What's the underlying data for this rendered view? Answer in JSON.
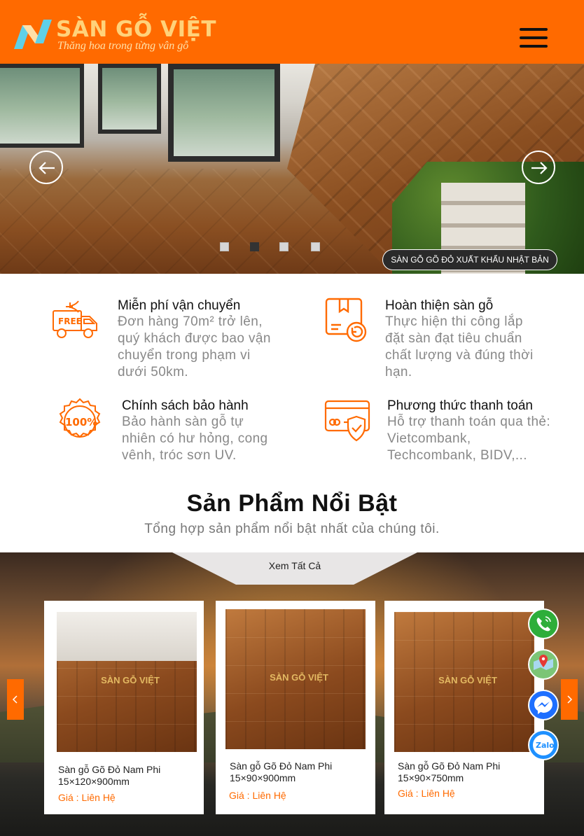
{
  "header": {
    "logo_name": "SÀN GỖ VIỆT",
    "logo_slogan": "Thăng hoa trong từng vân gỗ",
    "menu_icon": "hamburger-menu-icon",
    "background_color": "#ff6a00"
  },
  "slider": {
    "caption": "SÀN GỖ GÕ ĐỎ XUẤT KHẨU NHẬT BẢN",
    "prev_icon": "arrow-left-icon",
    "next_icon": "arrow-right-icon",
    "dot_count": 4,
    "active_dot": 2
  },
  "features": [
    {
      "icon": "free-delivery-truck-icon",
      "title": "Miễn phí vận chuyển",
      "text": "Đơn hàng 70m² trở lên, quý khách được bao vận chuyển trong phạm vi dưới 50km."
    },
    {
      "icon": "box-return-icon",
      "title": "Hoàn thiện sàn gỗ",
      "text": "Thực hiện thi công lắp đặt sàn đạt tiêu chuẩn chất lượng và đúng thời hạn."
    },
    {
      "icon": "guarantee-100-badge-icon",
      "title": "Chính sách bảo hành",
      "text": "Bảo hành sàn gỗ tự nhiên có hư hỏng, cong vênh, tróc sơn UV."
    },
    {
      "icon": "secure-card-payment-icon",
      "title": "Phương thức thanh toán",
      "text": "Hỗ trợ thanh toán qua thẻ: Vietcombank, Techcombank, BIDV,..."
    }
  ],
  "featured": {
    "title": "Sản Phẩm Nổi Bật",
    "subtitle": "Tổng hợp sản phẩm nổi bật nhất của chúng tôi.",
    "view_all": "Xem Tất Cả",
    "watermark": "SÀN GỖ VIỆT",
    "products": [
      {
        "name": "Sàn gỗ Gõ Đỏ Nam Phi 15×120×900mm",
        "price": "Giá : Liên Hệ"
      },
      {
        "name": "Sàn gỗ Gõ Đỏ Nam Phi 15×90×900mm",
        "price": "Giá : Liên Hệ"
      },
      {
        "name": "Sàn gỗ Gõ Đỏ Nam Phi 15×90×750mm",
        "price": "Giá : Liên Hệ"
      }
    ]
  },
  "contact_buttons": [
    {
      "icon": "phone-icon",
      "color": "#2eae3a"
    },
    {
      "icon": "map-pin-icon",
      "color": "#4caf50"
    },
    {
      "icon": "messenger-icon",
      "color": "#1e6fff"
    },
    {
      "icon": "zalo-icon",
      "color": "#1e90ff",
      "label": "Zalo"
    }
  ],
  "colors": {
    "accent": "#ff6a00",
    "text_muted": "#888888"
  }
}
